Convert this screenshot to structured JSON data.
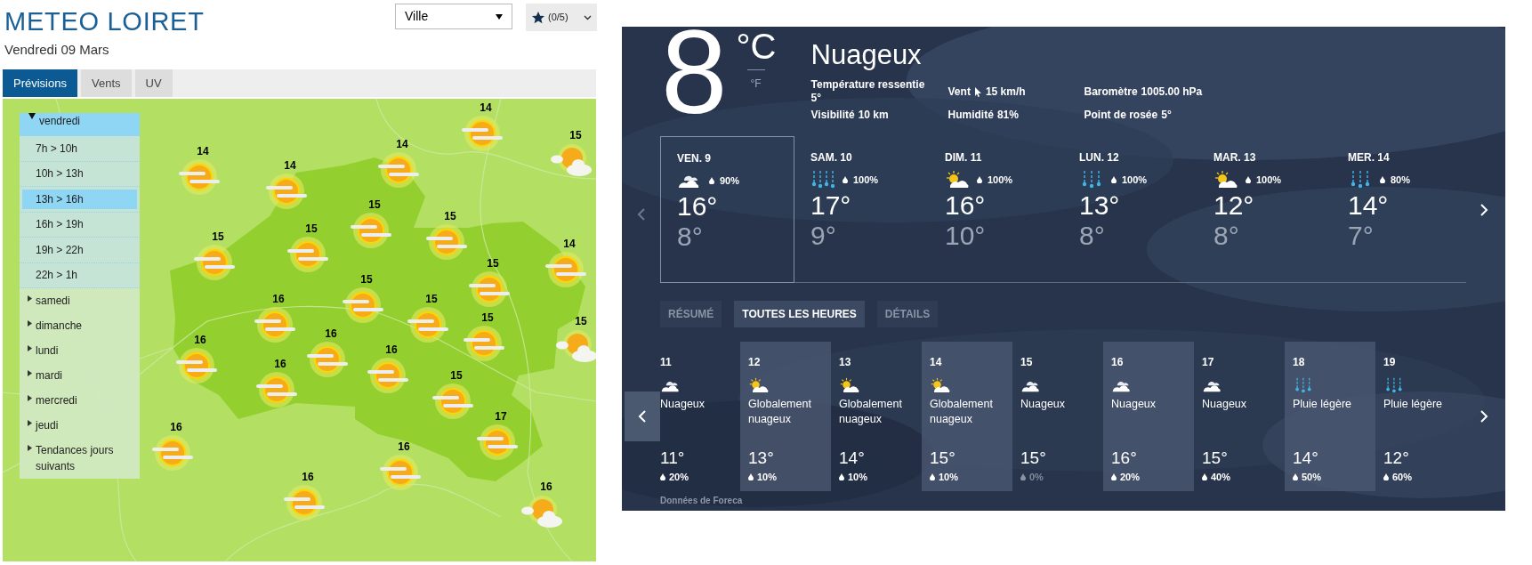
{
  "left": {
    "title": "METEO LOIRET",
    "date": "Vendredi 09 Mars",
    "city_select": {
      "value": "Ville"
    },
    "favorites": {
      "label": "(0/5)"
    },
    "tabs": [
      {
        "label": "Prévisions",
        "selected": true
      },
      {
        "label": "Vents",
        "selected": false
      },
      {
        "label": "UV",
        "selected": false
      }
    ],
    "forecast_menu": [
      {
        "label": "vendredi",
        "expanded": true,
        "children": [
          {
            "label": "7h > 10h",
            "selected": false
          },
          {
            "label": "10h > 13h",
            "selected": false
          },
          {
            "label": "13h > 16h",
            "selected": true
          },
          {
            "label": "16h > 19h",
            "selected": false
          },
          {
            "label": "19h > 22h",
            "selected": false
          },
          {
            "label": "22h > 1h",
            "selected": false
          }
        ]
      },
      {
        "label": "samedi",
        "expanded": false
      },
      {
        "label": "dimanche",
        "expanded": false
      },
      {
        "label": "lundi",
        "expanded": false
      },
      {
        "label": "mardi",
        "expanded": false
      },
      {
        "label": "mercredi",
        "expanded": false
      },
      {
        "label": "jeudi",
        "expanded": false
      },
      {
        "label": "Tendances jours suivants",
        "expanded": false
      }
    ],
    "map_markers": [
      {
        "temp": "14",
        "kind": "sun_fog"
      },
      {
        "temp": "14",
        "kind": "sun_fog"
      },
      {
        "temp": "14",
        "kind": "sun_fog"
      },
      {
        "temp": "14",
        "kind": "sun_fog"
      },
      {
        "temp": "15",
        "kind": "sun_cloud"
      },
      {
        "temp": "15",
        "kind": "sun_fog"
      },
      {
        "temp": "15",
        "kind": "sun_fog"
      },
      {
        "temp": "15",
        "kind": "sun_fog"
      },
      {
        "temp": "15",
        "kind": "sun_fog"
      },
      {
        "temp": "14",
        "kind": "sun_fog"
      },
      {
        "temp": "15",
        "kind": "sun_fog"
      },
      {
        "temp": "15",
        "kind": "sun_fog"
      },
      {
        "temp": "16",
        "kind": "sun_fog"
      },
      {
        "temp": "15",
        "kind": "sun_fog"
      },
      {
        "temp": "15",
        "kind": "sun_fog"
      },
      {
        "temp": "15",
        "kind": "sun_cloud"
      },
      {
        "temp": "16",
        "kind": "sun_fog"
      },
      {
        "temp": "16",
        "kind": "sun_fog"
      },
      {
        "temp": "16",
        "kind": "sun_fog"
      },
      {
        "temp": "16",
        "kind": "sun_fog"
      },
      {
        "temp": "15",
        "kind": "sun_fog"
      },
      {
        "temp": "17",
        "kind": "sun_fog"
      },
      {
        "temp": "16",
        "kind": "sun_fog"
      },
      {
        "temp": "16",
        "kind": "sun_fog"
      },
      {
        "temp": "16",
        "kind": "sun_fog"
      },
      {
        "temp": "16",
        "kind": "sun_cloud"
      }
    ]
  },
  "right": {
    "temperature": "8",
    "units": [
      {
        "label": "°C",
        "selected": true
      },
      {
        "label": "°F",
        "selected": false
      }
    ],
    "condition": "Nuageux",
    "details": [
      {
        "label": "Température ressentie",
        "value": "5°"
      },
      {
        "label": "Vent",
        "value": "15 km/h",
        "kind": "wind"
      },
      {
        "label": "Baromètre",
        "value": "1005.00 hPa"
      },
      {
        "label": "Visibilité",
        "value": "10 km"
      },
      {
        "label": "Humidité",
        "value": "81%"
      },
      {
        "label": "Point de rosée",
        "value": "5°"
      }
    ],
    "days": [
      {
        "day": "VEN. 9",
        "kind": "cloudy",
        "precip": "90%",
        "high": "16°",
        "low": "8°",
        "selected": true
      },
      {
        "day": "SAM. 10",
        "kind": "heavy_rain",
        "precip": "100%",
        "high": "17°",
        "low": "9°",
        "selected": false
      },
      {
        "day": "DIM. 11",
        "kind": "sun_cloud",
        "precip": "100%",
        "high": "16°",
        "low": "10°",
        "selected": false
      },
      {
        "day": "LUN. 12",
        "kind": "rain",
        "precip": "100%",
        "high": "13°",
        "low": "8°",
        "selected": false
      },
      {
        "day": "MAR. 13",
        "kind": "sun_cloud",
        "precip": "100%",
        "high": "12°",
        "low": "8°",
        "selected": false
      },
      {
        "day": "MER. 14",
        "kind": "rain",
        "precip": "80%",
        "high": "14°",
        "low": "7°",
        "selected": false
      }
    ],
    "tabs": [
      {
        "label": "RÉSUMÉ",
        "selected": false
      },
      {
        "label": "TOUTES LES HEURES",
        "selected": true
      },
      {
        "label": "DÉTAILS",
        "selected": false
      }
    ],
    "hours": [
      {
        "hour": "11",
        "kind": "cloudy",
        "label": "Nuageux",
        "temp": "11°",
        "precip": "20%",
        "dry": false
      },
      {
        "hour": "12",
        "kind": "sun_cloud",
        "label": "Globalement nuageux",
        "temp": "13°",
        "precip": "10%",
        "dry": false
      },
      {
        "hour": "13",
        "kind": "sun_cloud",
        "label": "Globalement nuageux",
        "temp": "14°",
        "precip": "10%",
        "dry": false
      },
      {
        "hour": "14",
        "kind": "sun_cloud",
        "label": "Globalement nuageux",
        "temp": "15°",
        "precip": "10%",
        "dry": false
      },
      {
        "hour": "15",
        "kind": "cloudy",
        "label": "Nuageux",
        "temp": "15°",
        "precip": "0%",
        "dry": true
      },
      {
        "hour": "16",
        "kind": "cloudy",
        "label": "Nuageux",
        "temp": "16°",
        "precip": "20%",
        "dry": false
      },
      {
        "hour": "17",
        "kind": "cloudy",
        "label": "Nuageux",
        "temp": "15°",
        "precip": "40%",
        "dry": false
      },
      {
        "hour": "18",
        "kind": "rain",
        "label": "Pluie légère",
        "temp": "14°",
        "precip": "50%",
        "dry": false
      },
      {
        "hour": "19",
        "kind": "rain",
        "label": "Pluie légère",
        "temp": "12°",
        "precip": "60%",
        "dry": false
      }
    ],
    "source": "Données de Foreca"
  }
}
